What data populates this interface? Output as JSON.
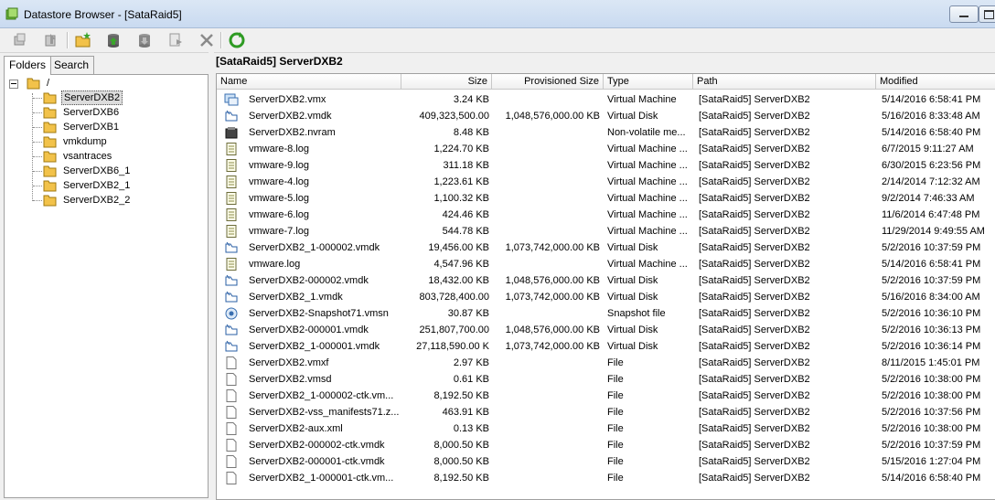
{
  "window": {
    "title": "Datastore Browser - [SataRaid5]"
  },
  "toolbar": {
    "buttons": [
      {
        "name": "upload-icon"
      },
      {
        "name": "download-icon"
      },
      {
        "name": "new-folder-icon"
      },
      {
        "name": "upload-file-icon"
      },
      {
        "name": "download-file-icon"
      },
      {
        "name": "register-vm-icon"
      },
      {
        "name": "delete-icon"
      },
      {
        "name": "refresh-icon"
      }
    ]
  },
  "left": {
    "tabs": [
      "Folders",
      "Search"
    ],
    "tree": {
      "root": "/",
      "children": [
        "ServerDXB2",
        "ServerDXB6",
        "ServerDXB1",
        "vmkdump",
        "vsantraces",
        "ServerDXB6_1",
        "ServerDXB2_1",
        "ServerDXB2_2"
      ],
      "selected": "ServerDXB2"
    }
  },
  "right": {
    "path": "[SataRaid5] ServerDXB2",
    "columns": [
      "Name",
      "Size",
      "Provisioned Size",
      "Type",
      "Path",
      "Modified"
    ],
    "rows": [
      {
        "icon": "vm",
        "name": "ServerDXB2.vmx",
        "size": "3.24 KB",
        "prov": "",
        "type": "Virtual Machine",
        "path": "[SataRaid5] ServerDXB2",
        "modified": "5/14/2016 6:58:41 PM"
      },
      {
        "icon": "disk",
        "name": "ServerDXB2.vmdk",
        "size": "409,323,500.00",
        "prov": "1,048,576,000.00 KB",
        "type": "Virtual Disk",
        "path": "[SataRaid5] ServerDXB2",
        "modified": "5/16/2016 8:33:48 AM"
      },
      {
        "icon": "nvram",
        "name": "ServerDXB2.nvram",
        "size": "8.48 KB",
        "prov": "",
        "type": "Non-volatile me...",
        "path": "[SataRaid5] ServerDXB2",
        "modified": "5/14/2016 6:58:40 PM"
      },
      {
        "icon": "log",
        "name": "vmware-8.log",
        "size": "1,224.70 KB",
        "prov": "",
        "type": "Virtual Machine ...",
        "path": "[SataRaid5] ServerDXB2",
        "modified": "6/7/2015 9:11:27 AM"
      },
      {
        "icon": "log",
        "name": "vmware-9.log",
        "size": "311.18 KB",
        "prov": "",
        "type": "Virtual Machine ...",
        "path": "[SataRaid5] ServerDXB2",
        "modified": "6/30/2015 6:23:56 PM"
      },
      {
        "icon": "log",
        "name": "vmware-4.log",
        "size": "1,223.61 KB",
        "prov": "",
        "type": "Virtual Machine ...",
        "path": "[SataRaid5] ServerDXB2",
        "modified": "2/14/2014 7:12:32 AM"
      },
      {
        "icon": "log",
        "name": "vmware-5.log",
        "size": "1,100.32 KB",
        "prov": "",
        "type": "Virtual Machine ...",
        "path": "[SataRaid5] ServerDXB2",
        "modified": "9/2/2014 7:46:33 AM"
      },
      {
        "icon": "log",
        "name": "vmware-6.log",
        "size": "424.46 KB",
        "prov": "",
        "type": "Virtual Machine ...",
        "path": "[SataRaid5] ServerDXB2",
        "modified": "11/6/2014 6:47:48 PM"
      },
      {
        "icon": "log",
        "name": "vmware-7.log",
        "size": "544.78 KB",
        "prov": "",
        "type": "Virtual Machine ...",
        "path": "[SataRaid5] ServerDXB2",
        "modified": "11/29/2014 9:49:55 AM"
      },
      {
        "icon": "disk",
        "name": "ServerDXB2_1-000002.vmdk",
        "size": "19,456.00 KB",
        "prov": "1,073,742,000.00 KB",
        "type": "Virtual Disk",
        "path": "[SataRaid5] ServerDXB2",
        "modified": "5/2/2016 10:37:59 PM"
      },
      {
        "icon": "log",
        "name": "vmware.log",
        "size": "4,547.96 KB",
        "prov": "",
        "type": "Virtual Machine ...",
        "path": "[SataRaid5] ServerDXB2",
        "modified": "5/14/2016 6:58:41 PM"
      },
      {
        "icon": "disk",
        "name": "ServerDXB2-000002.vmdk",
        "size": "18,432.00 KB",
        "prov": "1,048,576,000.00 KB",
        "type": "Virtual Disk",
        "path": "[SataRaid5] ServerDXB2",
        "modified": "5/2/2016 10:37:59 PM"
      },
      {
        "icon": "disk",
        "name": "ServerDXB2_1.vmdk",
        "size": "803,728,400.00",
        "prov": "1,073,742,000.00 KB",
        "type": "Virtual Disk",
        "path": "[SataRaid5] ServerDXB2",
        "modified": "5/16/2016 8:34:00 AM"
      },
      {
        "icon": "snapshot",
        "name": "ServerDXB2-Snapshot71.vmsn",
        "size": "30.87 KB",
        "prov": "",
        "type": "Snapshot file",
        "path": "[SataRaid5] ServerDXB2",
        "modified": "5/2/2016 10:36:10 PM"
      },
      {
        "icon": "disk",
        "name": "ServerDXB2-000001.vmdk",
        "size": "251,807,700.00",
        "prov": "1,048,576,000.00 KB",
        "type": "Virtual Disk",
        "path": "[SataRaid5] ServerDXB2",
        "modified": "5/2/2016 10:36:13 PM"
      },
      {
        "icon": "disk",
        "name": "ServerDXB2_1-000001.vmdk",
        "size": "27,118,590.00 K",
        "prov": "1,073,742,000.00 KB",
        "type": "Virtual Disk",
        "path": "[SataRaid5] ServerDXB2",
        "modified": "5/2/2016 10:36:14 PM"
      },
      {
        "icon": "file",
        "name": "ServerDXB2.vmxf",
        "size": "2.97 KB",
        "prov": "",
        "type": "File",
        "path": "[SataRaid5] ServerDXB2",
        "modified": "8/11/2015 1:45:01 PM"
      },
      {
        "icon": "file",
        "name": "ServerDXB2.vmsd",
        "size": "0.61 KB",
        "prov": "",
        "type": "File",
        "path": "[SataRaid5] ServerDXB2",
        "modified": "5/2/2016 10:38:00 PM"
      },
      {
        "icon": "file",
        "name": "ServerDXB2_1-000002-ctk.vm...",
        "size": "8,192.50 KB",
        "prov": "",
        "type": "File",
        "path": "[SataRaid5] ServerDXB2",
        "modified": "5/2/2016 10:38:00 PM"
      },
      {
        "icon": "file",
        "name": "ServerDXB2-vss_manifests71.z...",
        "size": "463.91 KB",
        "prov": "",
        "type": "File",
        "path": "[SataRaid5] ServerDXB2",
        "modified": "5/2/2016 10:37:56 PM"
      },
      {
        "icon": "file",
        "name": "ServerDXB2-aux.xml",
        "size": "0.13 KB",
        "prov": "",
        "type": "File",
        "path": "[SataRaid5] ServerDXB2",
        "modified": "5/2/2016 10:38:00 PM"
      },
      {
        "icon": "file",
        "name": "ServerDXB2-000002-ctk.vmdk",
        "size": "8,000.50 KB",
        "prov": "",
        "type": "File",
        "path": "[SataRaid5] ServerDXB2",
        "modified": "5/2/2016 10:37:59 PM"
      },
      {
        "icon": "file",
        "name": "ServerDXB2-000001-ctk.vmdk",
        "size": "8,000.50 KB",
        "prov": "",
        "type": "File",
        "path": "[SataRaid5] ServerDXB2",
        "modified": "5/15/2016 1:27:04 PM"
      },
      {
        "icon": "file",
        "name": "ServerDXB2_1-000001-ctk.vm...",
        "size": "8,192.50 KB",
        "prov": "",
        "type": "File",
        "path": "[SataRaid5] ServerDXB2",
        "modified": "5/14/2016 6:58:40 PM"
      }
    ]
  }
}
